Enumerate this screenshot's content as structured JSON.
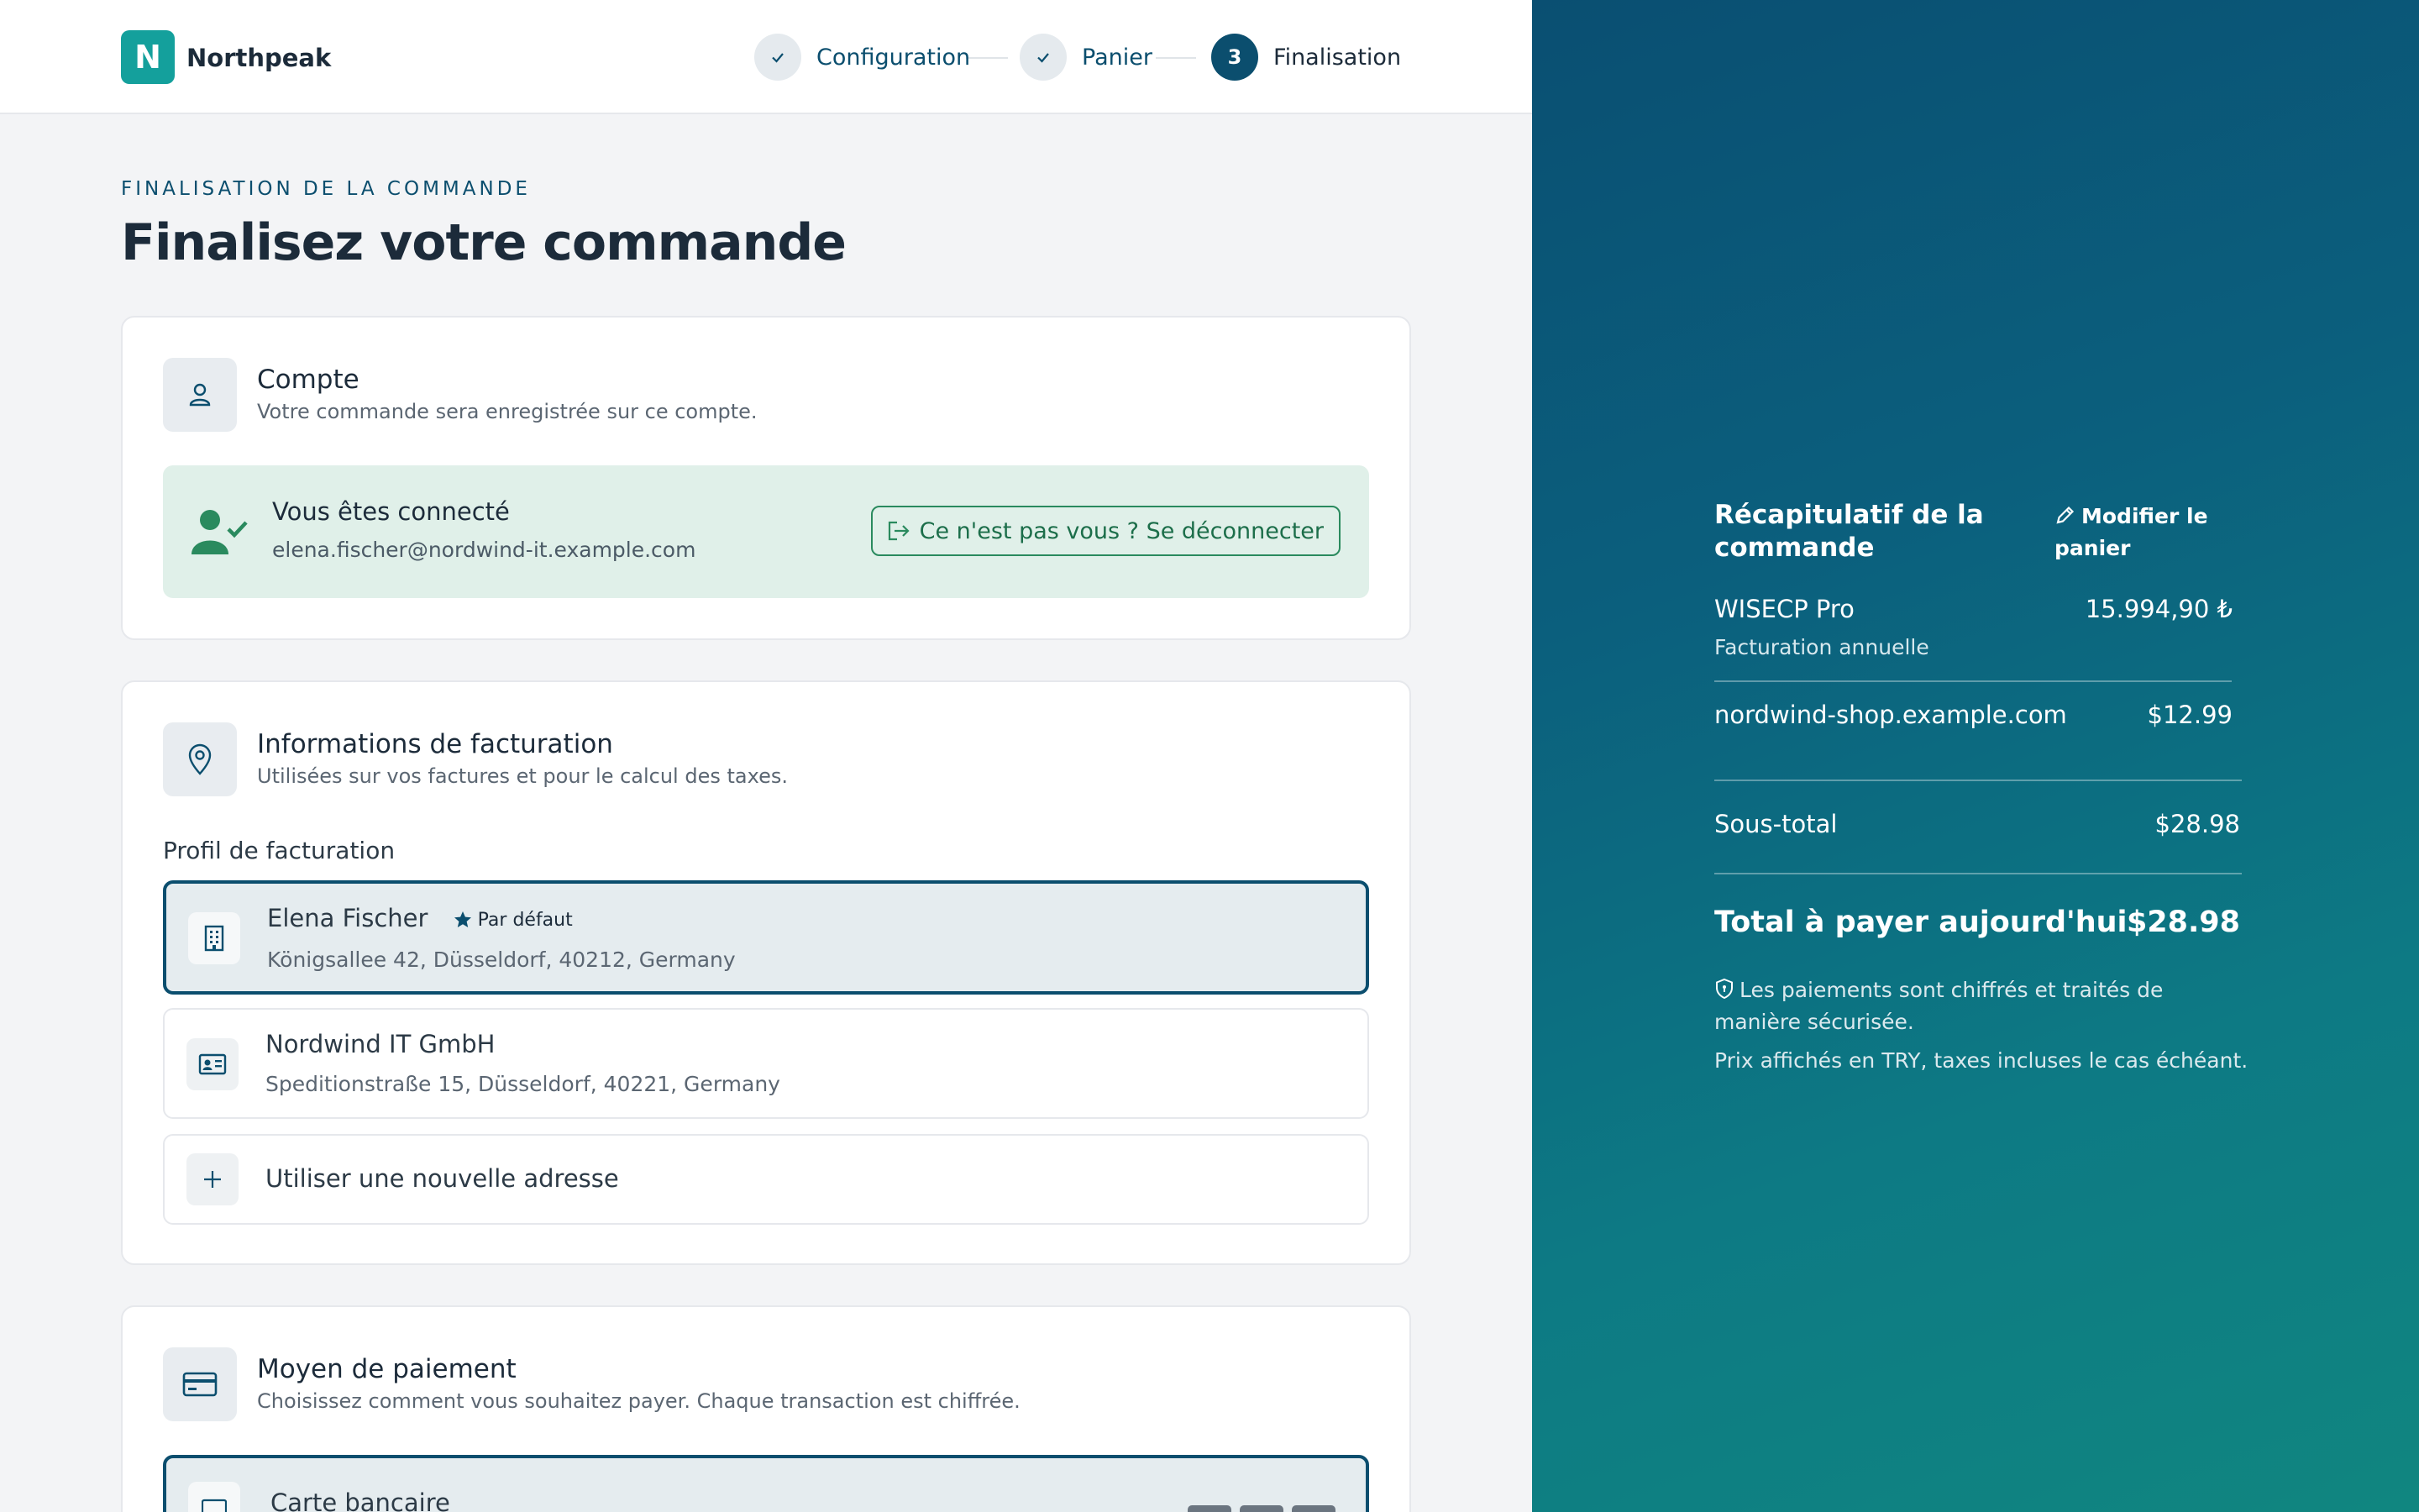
{
  "brand": {
    "logo_letter": "N",
    "name": "Northpeak",
    "color": "#14a09c"
  },
  "steps": [
    {
      "label": "Configuration",
      "state": "done",
      "icon": "check-icon"
    },
    {
      "label": "Panier",
      "state": "done",
      "icon": "check-icon"
    },
    {
      "number": "3",
      "label": "Finalisation",
      "state": "active"
    }
  ],
  "page": {
    "eyebrow": "FINALISATION DE LA COMMANDE",
    "title": "Finalisez votre commande"
  },
  "account": {
    "title": "Compte",
    "subtitle": "Votre commande sera enregistrée sur ce compte.",
    "connected_title": "Vous êtes connecté",
    "email": "elena.fischer@nordwind-it.example.com",
    "logout_label": "Ce n'est pas vous ? Se déconnecter"
  },
  "billing": {
    "title": "Informations de facturation",
    "subtitle": "Utilisées sur vos factures et pour le calcul des taxes.",
    "profile_label": "Profil de facturation",
    "profiles": [
      {
        "name": "Elena Fischer",
        "badge": "Par défaut",
        "address": "Königsallee 42, Düsseldorf, 40212, Germany",
        "selected": true,
        "icon": "building-icon"
      },
      {
        "name": "Nordwind IT GmbH",
        "address": "Speditionstraße 15, Düsseldorf, 40221, Germany",
        "selected": false,
        "icon": "id-card-icon"
      }
    ],
    "new_address_label": "Utiliser une nouvelle adresse"
  },
  "payment": {
    "title": "Moyen de paiement",
    "subtitle": "Choisissez comment vous souhaitez payer. Chaque transaction est chiffrée.",
    "method_label": "Carte bancaire"
  },
  "summary": {
    "title": "Récapitulatif de la commande",
    "edit_label": "Modifier le panier",
    "items": [
      {
        "name": "WISECP Pro",
        "sub": "Facturation annuelle",
        "price": "15.994,90 ₺"
      },
      {
        "name": "nordwind-shop.example.com",
        "price": "$12.99"
      }
    ],
    "subtotal_label": "Sous-total",
    "subtotal": "$28.98",
    "total_label": "Total à payer aujourd'hui",
    "total": "$28.98",
    "secure_note": "Les paiements sont chiffrés et traités de manière sécurisée.",
    "currency_note": "Prix affichés en TRY, taxes incluses le cas échéant."
  },
  "colors": {
    "accent": "#0b4e6e",
    "success_bg": "#e0f0e9",
    "success": "#2a8a5e"
  }
}
